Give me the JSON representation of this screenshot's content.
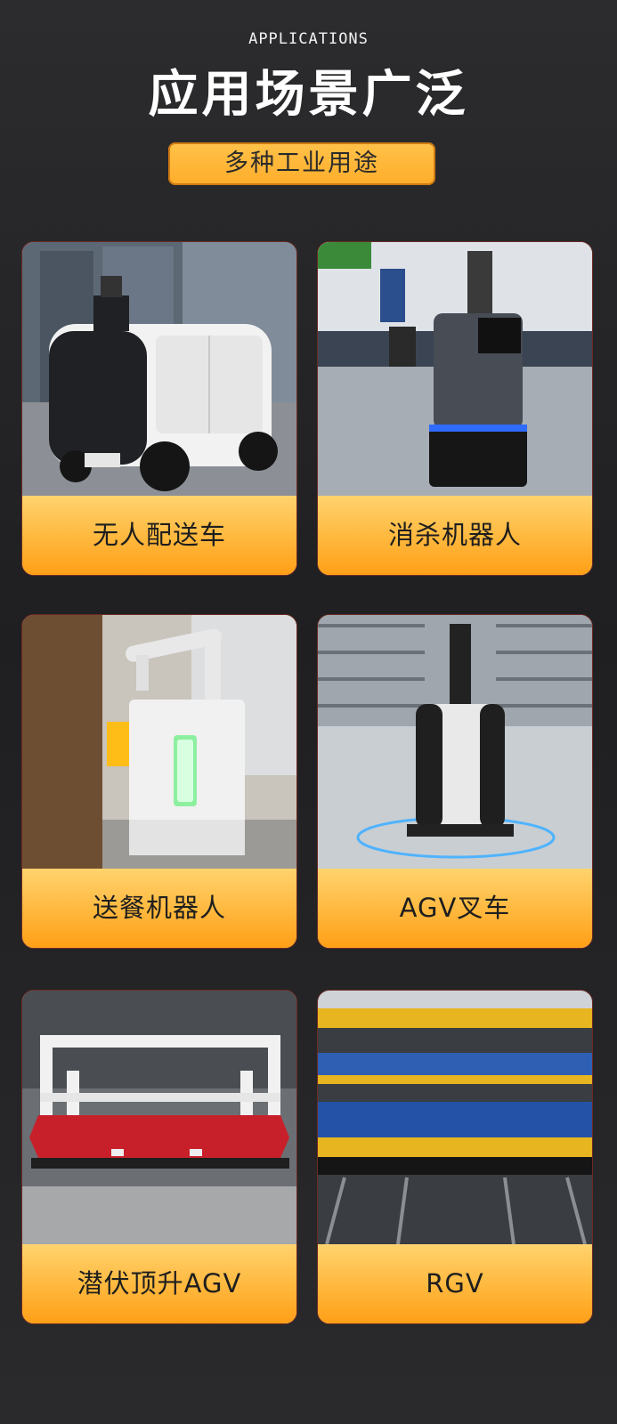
{
  "header": {
    "eyebrow": "APPLICATIONS",
    "title": "应用场景广泛",
    "subtitle": "多种工业用途"
  },
  "cards": [
    {
      "label": "无人配送车",
      "icon": "delivery-vehicle-photo"
    },
    {
      "label": "消杀机器人",
      "icon": "disinfection-robot-photo"
    },
    {
      "label": "送餐机器人",
      "icon": "food-delivery-robot-photo"
    },
    {
      "label": "AGV叉车",
      "icon": "agv-forklift-photo"
    },
    {
      "label": "潜伏顶升AGV",
      "icon": "jacking-agv-photo"
    },
    {
      "label": "RGV",
      "icon": "rgv-photo"
    }
  ],
  "colors": {
    "accent": "#ffb73c",
    "background": "#252527"
  }
}
